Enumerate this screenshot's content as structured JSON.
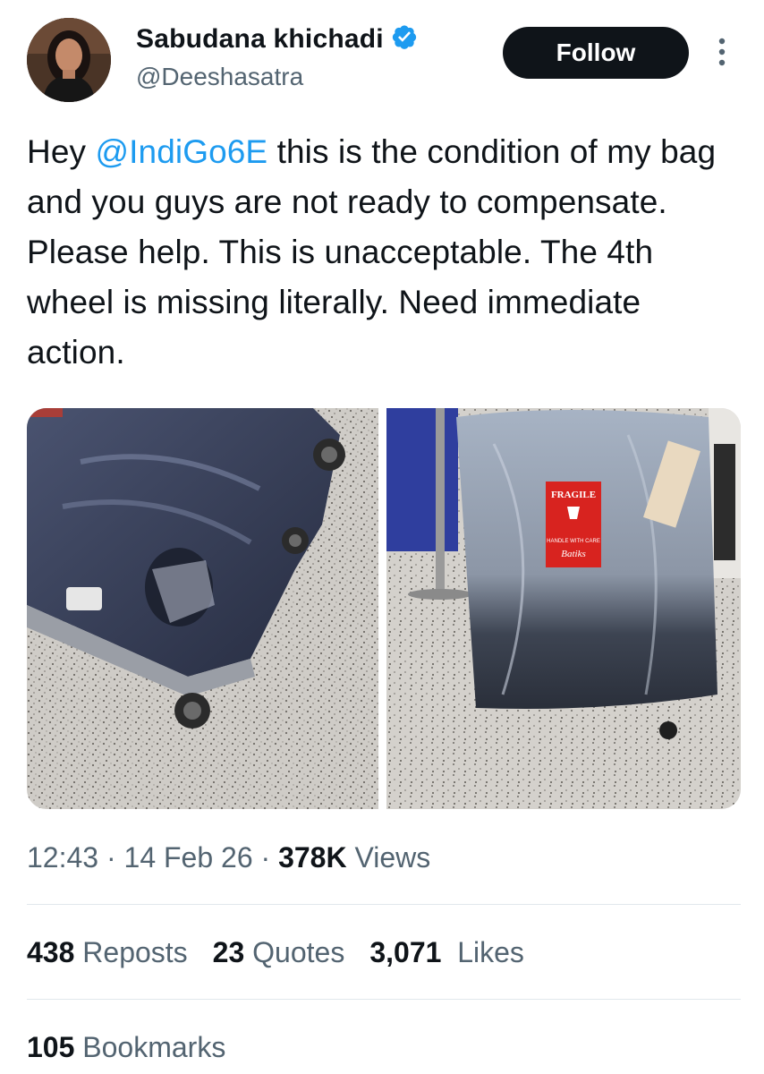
{
  "author": {
    "display_name": "Sabudana khichadi",
    "handle": "@Deeshasatra",
    "verified_icon": "verified-badge-icon",
    "accent_color": "#1d9bf0"
  },
  "follow_label": "Follow",
  "tweet": {
    "before": "Hey ",
    "mention": "@IndiGo6E",
    "after": " this is the condition of my bag and you guys are not ready to compensate. Please help. This is unacceptable. The 4th wheel is missing literally. Need immediate action."
  },
  "photos": {
    "left_sticker": "",
    "right_sticker_title": "FRAGILE",
    "right_sticker_sub": "HANDLE WITH CARE",
    "right_sticker_brand": "Batiks"
  },
  "meta": {
    "time": "12:43",
    "date": "14 Feb 26",
    "views_count": "378K",
    "views_label": "Views"
  },
  "stats": {
    "reposts_count": "438",
    "reposts_label": "Reposts",
    "quotes_count": "23",
    "quotes_label": "Quotes",
    "likes_count": "3,071",
    "likes_label": "Likes",
    "bookmarks_count": "105",
    "bookmarks_label": "Bookmarks"
  }
}
